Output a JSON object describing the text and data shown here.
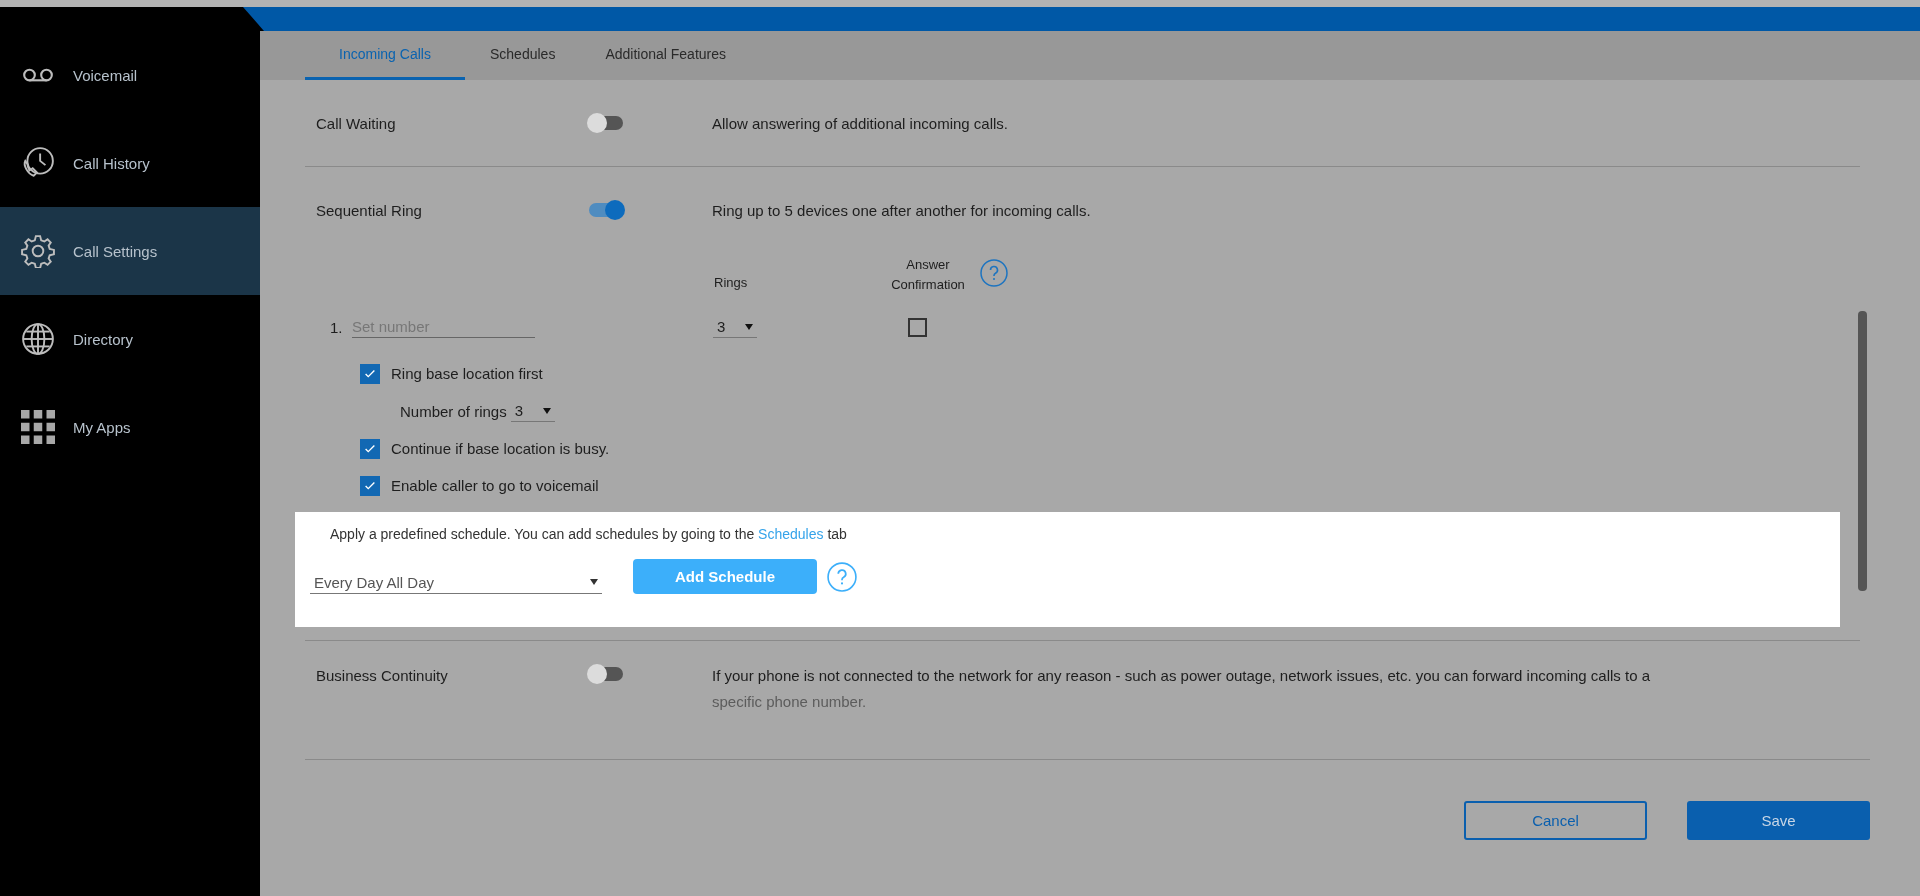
{
  "sidebar": {
    "items": [
      {
        "label": "Voicemail",
        "selected": false
      },
      {
        "label": "Call History",
        "selected": false
      },
      {
        "label": "Call Settings",
        "selected": true
      },
      {
        "label": "Directory",
        "selected": false
      },
      {
        "label": "My Apps",
        "selected": false
      }
    ]
  },
  "tabs": [
    {
      "label": "Incoming Calls",
      "selected": true
    },
    {
      "label": "Schedules",
      "selected": false
    },
    {
      "label": "Additional Features",
      "selected": false
    }
  ],
  "call_waiting": {
    "label": "Call Waiting",
    "on": false,
    "description": "Allow answering of additional incoming calls."
  },
  "sequential_ring": {
    "label": "Sequential Ring",
    "on": true,
    "description": "Ring up to 5 devices one after another for incoming calls.",
    "rings_header": "Rings",
    "answer_confirmation_header": "Answer Confirmation",
    "devices": [
      {
        "index": "1.",
        "placeholder": "Set number",
        "rings": "3",
        "answer_confirmation": false
      }
    ],
    "options": [
      {
        "kind": "checkbox",
        "label": "Ring base location first",
        "checked": true
      },
      {
        "kind": "select",
        "label": "Number of rings",
        "value": "3"
      },
      {
        "kind": "checkbox",
        "label": "Continue if base location is busy.",
        "checked": true
      },
      {
        "kind": "checkbox",
        "label": "Enable caller to go to voicemail",
        "checked": true
      }
    ]
  },
  "schedule_panel": {
    "text": "Apply a predefined schedule. You can add schedules by going to the",
    "link": "Schedules",
    "text_after": "tab",
    "select": "Every Day All Day",
    "button": "Add Schedule"
  },
  "business_continuity": {
    "label": "Business Continuity",
    "on": false,
    "lines": [
      "If your phone is not connected to the network for any reason - such as power outage, network issues, etc. you can forward incoming calls to a",
      "specific phone number."
    ]
  },
  "buttons": {
    "cancel": "Cancel",
    "save": "Save"
  }
}
